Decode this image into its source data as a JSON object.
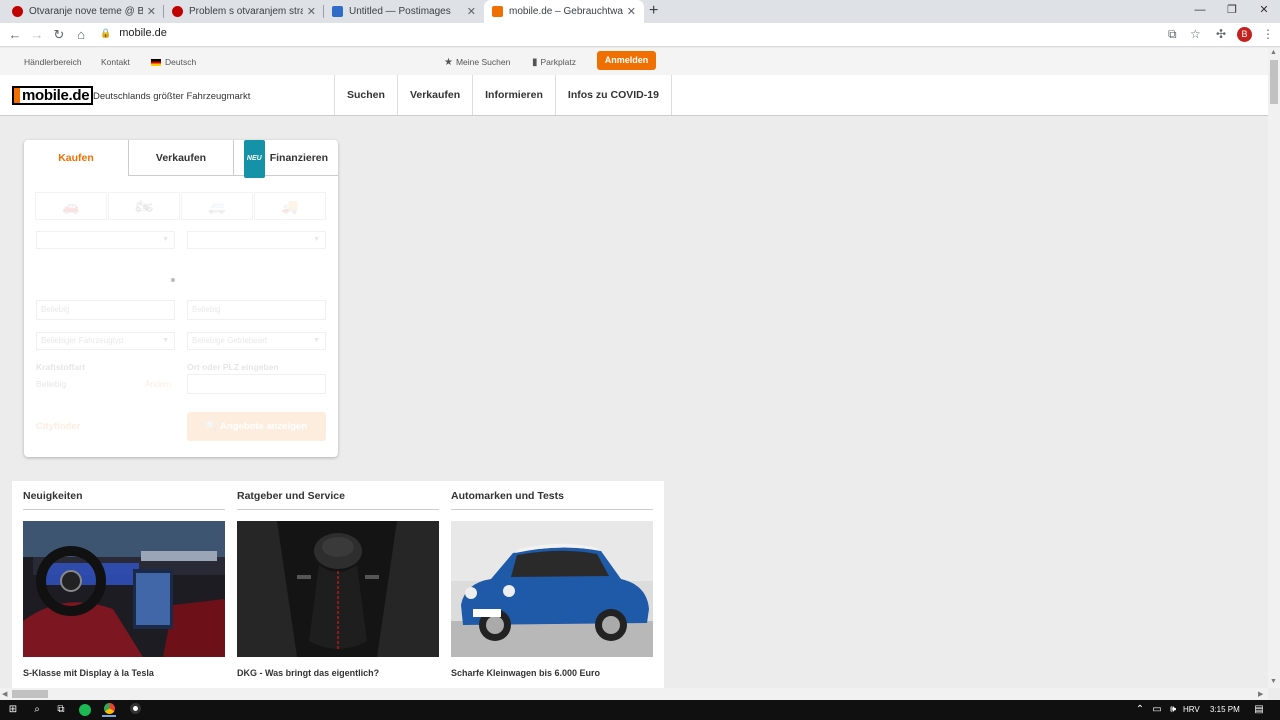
{
  "browser": {
    "tabs": [
      {
        "title": "Otvaranje nove teme @ Bug.hr F",
        "favicon_color": "#c00000"
      },
      {
        "title": "Problem s otvaranjem stranica, n",
        "favicon_color": "#c00000"
      },
      {
        "title": "Untitled — Postimages",
        "favicon_color": "#2f6cc9"
      },
      {
        "title": "mobile.de – Gebrauchtwagen un",
        "favicon_color": "#ef7000"
      }
    ],
    "url": "mobile.de"
  },
  "topnav": {
    "haendler": "Händlerbereich",
    "kontakt": "Kontakt",
    "language": "Deutsch",
    "meine_suchen": "Meine Suchen",
    "parkplatz": "Parkplatz",
    "anmelden": "Anmelden"
  },
  "header": {
    "logo": "mobile.de",
    "tagline": "Deutschlands größter Fahrzeugmarkt",
    "nav": [
      "Suchen",
      "Verkaufen",
      "Informieren",
      "Infos zu COVID-19"
    ]
  },
  "search": {
    "tabs": {
      "buy": "Kaufen",
      "sell": "Verkaufen",
      "finance_badge": "NEU",
      "finance": "Finanzieren"
    },
    "placeholder_from": "Beliebig",
    "placeholder_to": "Beliebig",
    "vehicle_type": "Beliebiger Fahrzeugtyp",
    "transmission": "Beliebige Getriebeart",
    "fuel_label": "Kraftstoffart",
    "fuel_value": "Beliebig",
    "fuel_action": "Ändern",
    "location_label": "Ort oder PLZ eingeben",
    "free_text": "Cityfinder",
    "submit": "Angebote anzeigen"
  },
  "news": [
    {
      "heading": "Neuigkeiten",
      "caption": "S-Klasse mit Display à la Tesla"
    },
    {
      "heading": "Ratgeber und Service",
      "caption": "DKG - Was bringt das eigentlich?"
    },
    {
      "heading": "Automarken und Tests",
      "caption": "Scharfe Kleinwagen bis 6.000 Euro"
    }
  ],
  "taskbar": {
    "language": "HRV",
    "time": "3:15 PM"
  },
  "colors": {
    "accent": "#ef7000",
    "badge": "#1592a8"
  }
}
